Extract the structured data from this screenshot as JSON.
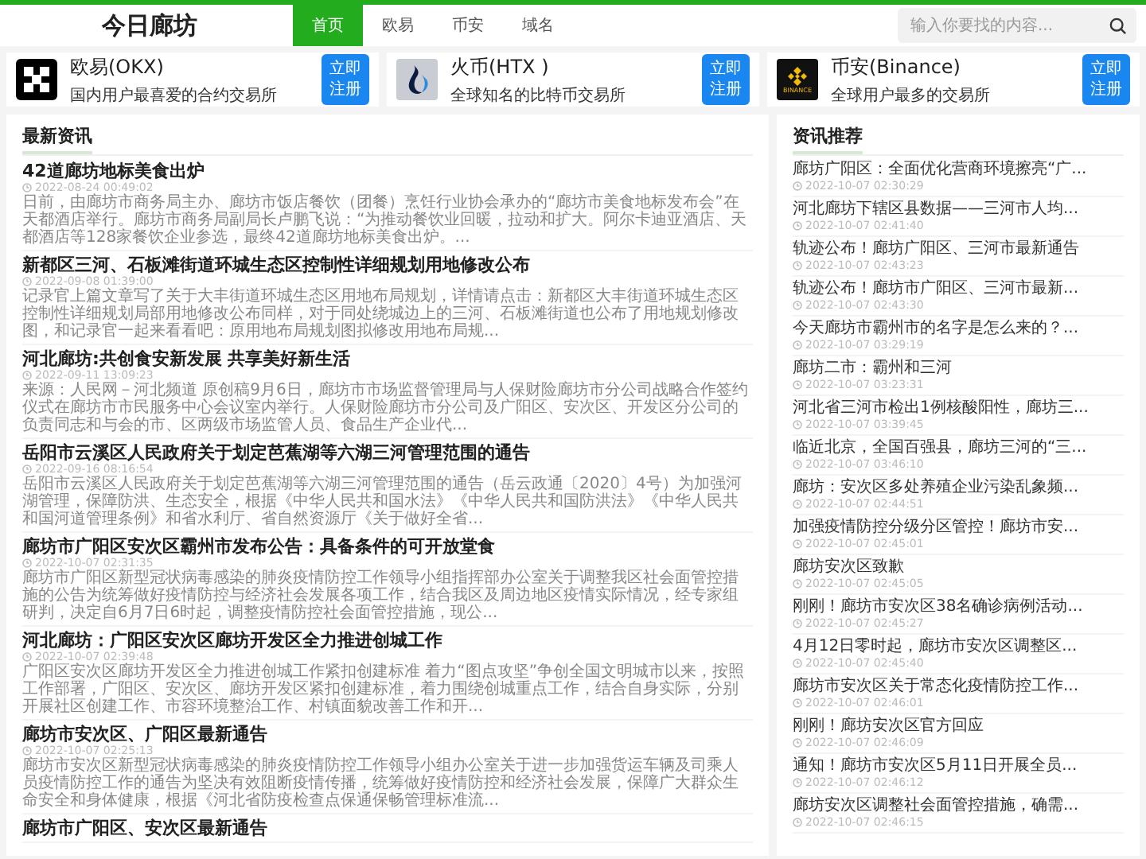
{
  "site_title": "今日廊坊",
  "nav": [
    {
      "label": "首页",
      "selected": true
    },
    {
      "label": "欧易",
      "selected": false
    },
    {
      "label": "币安",
      "selected": false
    },
    {
      "label": "域名",
      "selected": false
    }
  ],
  "search": {
    "placeholder": "输入你要找的内容..."
  },
  "exchanges": [
    {
      "kind": "okx",
      "name": "欧易(OKX)",
      "desc": "国内用户最喜爱的合约交易所",
      "button": "立即注册"
    },
    {
      "kind": "htx",
      "name": "火币(HTX )",
      "desc": "全球知名的比特币交易所",
      "button": "立即注册"
    },
    {
      "kind": "binance",
      "name": "币安(Binance)",
      "desc": "全球用户最多的交易所",
      "button": "立即注册",
      "logo_text": "BINANCE"
    }
  ],
  "latest": {
    "heading": "最新资讯",
    "items": [
      {
        "title": "42道廊坊地标美食出炉",
        "date": "2022-08-24 00:49:02",
        "summary": "日前，由廊坊市商务局主办、廊坊市饭店餐饮（团餐）烹饪行业协会承办的“廊坊市美食地标发布会”在天都酒店举行。廊坊市商务局副局长卢鹏飞说：“为推动餐饮业回暖，拉动和扩大。阿尔卡迪亚酒店、天都酒店等128家餐饮企业参选，最终42道廊坊地标美食出炉。..."
      },
      {
        "title": "新都区三河、石板滩街道环城生态区控制性详细规划用地修改公布",
        "date": "2022-09-08 01:39:00",
        "summary": "记录官上篇文章写了关于大丰街道环城生态区用地布局规划，详情请点击：新都区大丰街道环城生态区控制性详细规划局部用地修改公布同样，对于同处绕城边上的三河、石板滩街道也公布了用地规划修改图，和记录官一起来看看吧：原用地布局规划图拟修改用地布局规..."
      },
      {
        "title": "河北廊坊:共创食安新发展 共享美好新生活",
        "date": "2022-09-11 13:09:23",
        "summary": "来源：人民网－河北频道 原创稿9月6日，廊坊市市场监督管理局与人保财险廊坊市分公司战略合作签约仪式在廊坊市市民服务中心会议室内举行。人保财险廊坊市分公司及广阳区、安次区、开发区分公司的负责同志和与会的市、区两级市场监管人员、食品生产企业代..."
      },
      {
        "title": "岳阳市云溪区人民政府关于划定芭蕉湖等六湖三河管理范围的通告",
        "date": "2022-09-16 08:16:54",
        "summary": "岳阳市云溪区人民政府关于划定芭蕉湖等六湖三河管理范围的通告（岳云政通〔2020〕4号）为加强河湖管理，保障防洪、生态安全，根据《中华人民共和国水法》《中华人民共和国防洪法》《中华人民共和国河道管理条例》和省水利厅、省自然资源厅《关于做好全省..."
      },
      {
        "title": "廊坊市广阳区安次区霸州市发布公告：具备条件的可开放堂食",
        "date": "2022-10-07 02:31:35",
        "summary": "廊坊市广阳区新型冠状病毒感染的肺炎疫情防控工作领导小组指挥部办公室关于调整我区社会面管控措施的公告为统筹做好疫情防控与经济社会发展各项工作，结合我区及周边地区疫情实际情况，经专家组研判，决定自6月7日6时起，调整疫情防控社会面管控措施，现公..."
      },
      {
        "title": "河北廊坊：广阳区安次区廊坊开发区全力推进创城工作",
        "date": "2022-10-07 02:39:48",
        "summary": "广阳区安次区廊坊开发区全力推进创城工作紧扣创建标准 着力“图点攻坚”争创全国文明城市以来，按照工作部署，广阳区、安次区、廊坊开发区紧扣创建标准，着力围绕创城重点工作，结合自身实际，分别开展社区创建工作、市容环境整治工作、村镇面貌改善工作和开..."
      },
      {
        "title": "廊坊市安次区、广阳区最新通告",
        "date": "2022-10-07 02:25:13",
        "summary": "廊坊市安次区新型冠状病毒感染的肺炎疫情防控工作领导小组办公室关于进一步加强货运车辆及司乘人员疫情防控工作的通告为坚决有效阻断疫情传播，统筹做好疫情防控和经济社会发展，保障广大群众生命安全和身体健康，根据《河北省防疫检查点保通保畅管理标准流..."
      },
      {
        "title": "廊坊市广阳区、安次区最新通告"
      }
    ]
  },
  "recommended": {
    "heading": "资讯推荐",
    "items": [
      {
        "title": "廊坊广阳区：全面优化营商环境擦亮“广...",
        "date": "2022-10-07 02:30:29"
      },
      {
        "title": "河北廊坊下辖区县数据——三河市人均...",
        "date": "2022-10-07 02:41:40"
      },
      {
        "title": "轨迹公布！廊坊广阳区、三河市最新通告",
        "date": "2022-10-07 02:43:23"
      },
      {
        "title": "轨迹公布！廊坊市广阳区、三河市最新...",
        "date": "2022-10-07 02:43:30"
      },
      {
        "title": "今天廊坊市霸州市的名字是怎么来的？...",
        "date": "2022-10-07 03:29:19"
      },
      {
        "title": "廊坊二市：霸州和三河",
        "date": "2022-10-07 03:23:31"
      },
      {
        "title": "河北省三河市检出1例核酸阳性，廊坊三...",
        "date": "2022-10-07 03:39:45"
      },
      {
        "title": "临近北京，全国百强县，廊坊三河的“三...",
        "date": "2022-10-07 03:46:10"
      },
      {
        "title": "廊坊：安次区多处养殖企业污染乱象频...",
        "date": "2022-10-07 02:44:51"
      },
      {
        "title": "加强疫情防控分级分区管控！廊坊市安...",
        "date": "2022-10-07 02:45:01"
      },
      {
        "title": "廊坊安次区致歉",
        "date": "2022-10-07 02:45:05"
      },
      {
        "title": "刚刚！廊坊市安次区38名确诊病例活动...",
        "date": "2022-10-07 02:45:27"
      },
      {
        "title": "4月12日零时起，廊坊市安次区调整区...",
        "date": "2022-10-07 02:45:40"
      },
      {
        "title": "廊坊市安次区关于常态化疫情防控工作...",
        "date": "2022-10-07 02:46:01"
      },
      {
        "title": "刚刚！廊坊安次区官方回应",
        "date": "2022-10-07 02:46:09"
      },
      {
        "title": "通知！廊坊市安次区5月11日开展全员...",
        "date": "2022-10-07 02:46:12"
      },
      {
        "title": "廊坊安次区调整社会面管控措施，确需...",
        "date": "2022-10-07 02:46:15"
      }
    ]
  }
}
